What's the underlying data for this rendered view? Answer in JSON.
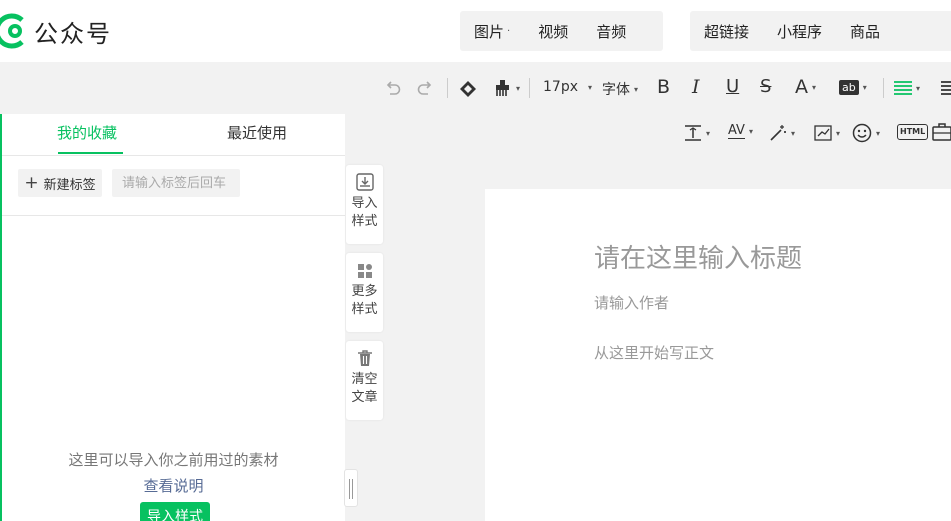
{
  "app": {
    "name": "公众号",
    "accent_color": "#07c160"
  },
  "media_bar": {
    "group1": [
      {
        "label": "图片",
        "dot": "·"
      },
      {
        "label": "视频"
      },
      {
        "label": "音频"
      }
    ],
    "group2": [
      {
        "label": "超链接"
      },
      {
        "label": "小程序"
      },
      {
        "label": "商品"
      }
    ]
  },
  "toolbar": {
    "font_size": "17px",
    "font_family": "字体",
    "bold": "B",
    "italic": "I",
    "underline": "U",
    "strike": "S",
    "font_color": "A",
    "highlight": "ab",
    "letter_spacing": "AV",
    "html": "HTML"
  },
  "panel": {
    "tabs": [
      {
        "label": "我的收藏",
        "active": true
      },
      {
        "label": "最近使用",
        "active": false
      }
    ],
    "new_tag_label": "新建标签",
    "tag_input_placeholder": "请输入标签后回车",
    "empty_hint": "这里可以导入你之前用过的素材",
    "view_guide": "查看说明",
    "import_button": "导入样式"
  },
  "side_actions": [
    {
      "icon": "import-icon",
      "line1": "导入",
      "line2": "样式"
    },
    {
      "icon": "grid-icon",
      "line1": "更多",
      "line2": "样式"
    },
    {
      "icon": "trash-icon",
      "line1": "清空",
      "line2": "文章"
    }
  ],
  "editor": {
    "title_placeholder": "请在这里输入标题",
    "author_placeholder": "请输入作者",
    "body_placeholder": "从这里开始写正文"
  }
}
